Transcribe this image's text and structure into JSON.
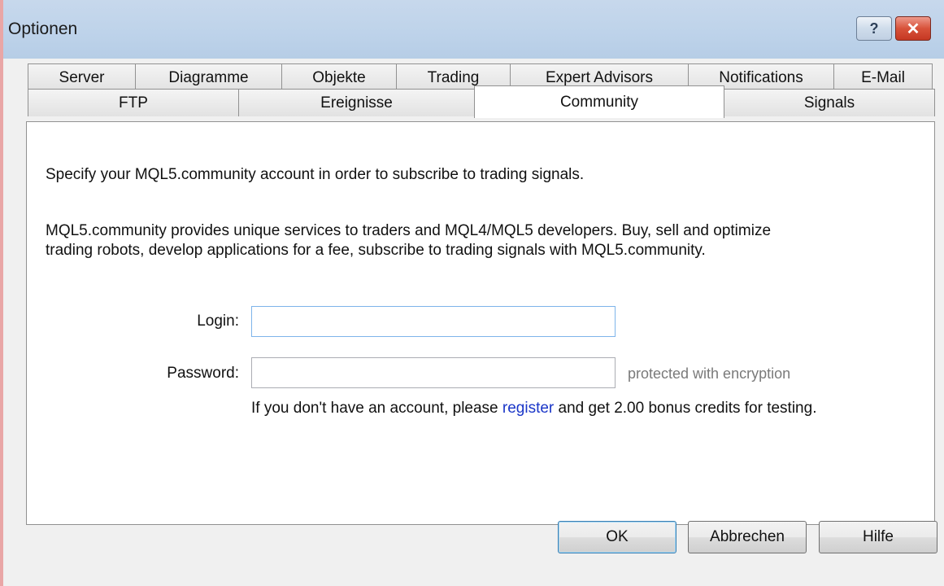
{
  "window": {
    "title": "Optionen"
  },
  "titlebar": {
    "help_glyph": "?",
    "close_glyph": "✕",
    "help_icon": "help-icon",
    "close_icon": "close-icon"
  },
  "tabs": {
    "row1": [
      "Server",
      "Diagramme",
      "Objekte",
      "Trading",
      "Expert Advisors",
      "Notifications",
      "E-Mail"
    ],
    "row2": [
      "FTP",
      "Ereignisse",
      "Community",
      "Signals"
    ],
    "active": "Community"
  },
  "community": {
    "intro": "Specify your MQL5.community account in order to subscribe to trading signals.",
    "description_line1": "MQL5.community provides unique services to traders and MQL4/MQL5 developers. Buy, sell and optimize",
    "description_line2": "trading robots, develop applications for a fee, subscribe to trading signals with MQL5.community.",
    "login_label": "Login:",
    "login_value": "",
    "password_label": "Password:",
    "password_value": "",
    "password_hint": "protected with encryption",
    "register_prefix": "If you don't have an account, please ",
    "register_link": "register",
    "register_suffix": " and get 2.00 bonus credits for testing."
  },
  "buttons": {
    "ok": "OK",
    "cancel": "Abbrechen",
    "help": "Hilfe"
  },
  "colors": {
    "link": "#1a36c8",
    "focus_border": "#7eb4ea",
    "close_red": "#d8523a"
  }
}
